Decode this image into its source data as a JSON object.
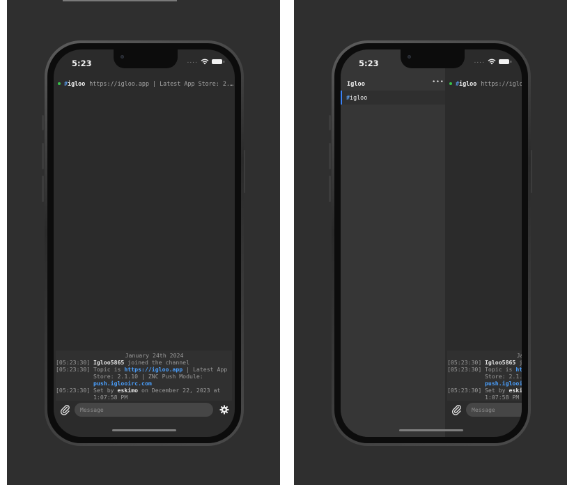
{
  "status": {
    "time": "5:23",
    "signal_dots": "...."
  },
  "channel": {
    "hash": "#",
    "name": "igloo",
    "topic": "https://igloo.app | Latest App Store: 2.1.10 | ZNC Push Module: push.iglooirc.com"
  },
  "messages": {
    "date_separator": "January 24th 2024",
    "rows": [
      {
        "ts": "[05:23:30]",
        "nick": "Igloo5865",
        "text": " joined the channel"
      },
      {
        "ts": "[05:23:30]",
        "prefix": "Topic is ",
        "link1": "https://igloo.app",
        "mid": " | Latest App Store: 2.1.10 | ZNC Push Module: ",
        "link2": "push.iglooirc.com"
      },
      {
        "ts": "[05:23:30]",
        "prefix": "Set by ",
        "nick": "eskimo",
        "text": " on December 22, 2023 at 1:07:58 PM"
      }
    ]
  },
  "composer": {
    "placeholder": "Message"
  },
  "sidebar": {
    "network": "Igloo",
    "more": "•••",
    "channel_item": "igloo"
  },
  "colors": {
    "accent_blue": "#4aa0ff",
    "online_green": "#39c24a",
    "background": "#2b2b2b"
  },
  "icons": {
    "attach": "paperclip-icon",
    "settings": "gear-icon",
    "wifi": "wifi-icon",
    "battery": "battery-icon"
  }
}
